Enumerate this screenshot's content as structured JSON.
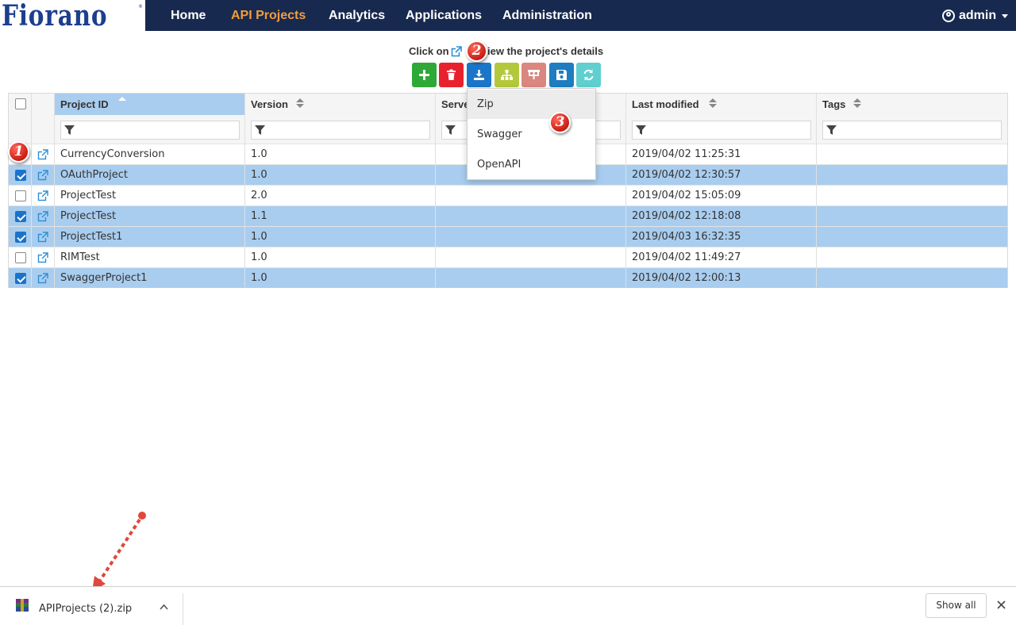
{
  "brand": {
    "logo": "Fiorano",
    "reg_mark": "®"
  },
  "nav": {
    "items": [
      {
        "label": "Home",
        "active": false
      },
      {
        "label": "API Projects",
        "active": true
      },
      {
        "label": "Analytics",
        "active": false
      },
      {
        "label": "Applications",
        "active": false
      },
      {
        "label": "Administration",
        "active": false
      }
    ],
    "user": "admin"
  },
  "colors": {
    "nav_bg": "#17294f",
    "nav_active": "#f39c3b",
    "selected_row": "#a9cdef",
    "add": "#2ea836",
    "delete": "#e8222d",
    "export": "#1b75c8",
    "hierarchy": "#b4c83c",
    "deploy": "#d9877f",
    "save": "#1e7cc0",
    "refresh": "#5fcfd0"
  },
  "hint": {
    "prefix": "Click on",
    "suffix": "iew the project's details"
  },
  "toolbar": [
    {
      "icon": "plus-icon"
    },
    {
      "icon": "trash-icon"
    },
    {
      "icon": "download-icon"
    },
    {
      "icon": "sitemap-icon"
    },
    {
      "icon": "deploy-icon"
    },
    {
      "icon": "save-icon"
    },
    {
      "icon": "refresh-icon"
    }
  ],
  "grid": {
    "columns": [
      {
        "label": "Project ID",
        "sort": "asc"
      },
      {
        "label": "Version",
        "sort": "both"
      },
      {
        "label": "Serve",
        "sort": "none"
      },
      {
        "label": "Last modified",
        "sort": "both"
      },
      {
        "label": "Tags",
        "sort": "both"
      }
    ],
    "rows": [
      {
        "checked": false,
        "project_id": "CurrencyConversion",
        "version": "1.0",
        "server": "",
        "last_modified": "2019/04/02 11:25:31",
        "tags": ""
      },
      {
        "checked": true,
        "project_id": "OAuthProject",
        "version": "1.0",
        "server": "",
        "last_modified": "2019/04/02 12:30:57",
        "tags": ""
      },
      {
        "checked": false,
        "project_id": "ProjectTest",
        "version": "2.0",
        "server": "",
        "last_modified": "2019/04/02 15:05:09",
        "tags": ""
      },
      {
        "checked": true,
        "project_id": "ProjectTest",
        "version": "1.1",
        "server": "",
        "last_modified": "2019/04/02 12:18:08",
        "tags": ""
      },
      {
        "checked": true,
        "project_id": "ProjectTest1",
        "version": "1.0",
        "server": "",
        "last_modified": "2019/04/03 16:32:35",
        "tags": ""
      },
      {
        "checked": false,
        "project_id": "RIMTest",
        "version": "1.0",
        "server": "",
        "last_modified": "2019/04/02 11:49:27",
        "tags": ""
      },
      {
        "checked": true,
        "project_id": "SwaggerProject1",
        "version": "1.0",
        "server": "",
        "last_modified": "2019/04/02 12:00:13",
        "tags": ""
      }
    ]
  },
  "export_menu": {
    "items": [
      "Zip",
      "Swagger",
      "OpenAPI"
    ],
    "highlighted": "Zip"
  },
  "callouts": [
    "1",
    "2",
    "3"
  ],
  "download": {
    "file_name": "APIProjects (2).zip",
    "show_all": "Show all"
  }
}
